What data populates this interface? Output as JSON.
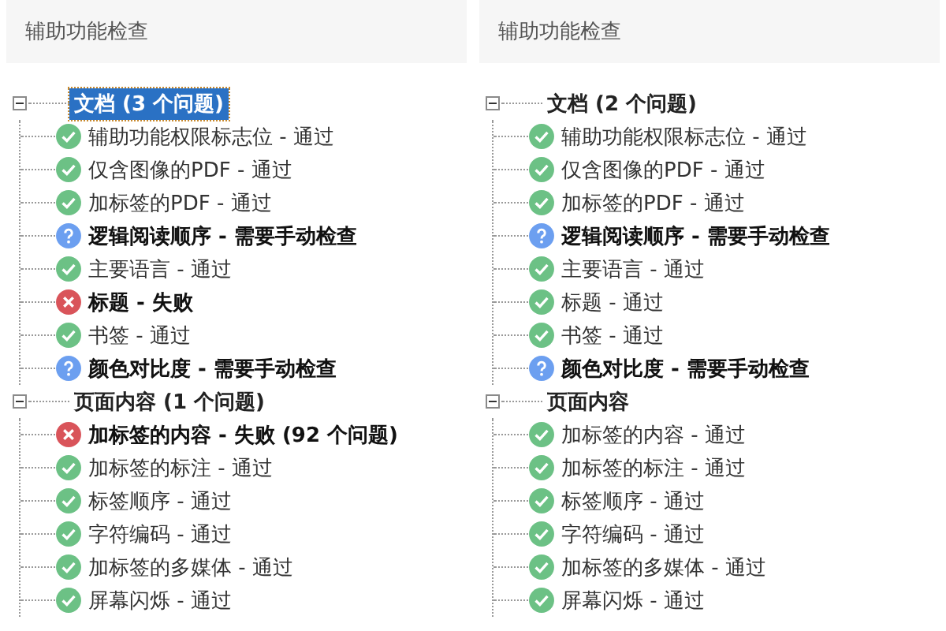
{
  "panels": [
    {
      "title": "辅助功能检查",
      "sections": [
        {
          "label": "文档 (3 个问题)",
          "selected": true,
          "expanded": true,
          "items": [
            {
              "label": "辅助功能权限标志位 - 通过",
              "kind": "pass"
            },
            {
              "label": "仅含图像的PDF - 通过",
              "kind": "pass"
            },
            {
              "label": "加标签的PDF - 通过",
              "kind": "pass"
            },
            {
              "label": "逻辑阅读顺序 - 需要手动检查",
              "kind": "manual"
            },
            {
              "label": "主要语言 - 通过",
              "kind": "pass"
            },
            {
              "label": "标题 - 失败",
              "kind": "fail"
            },
            {
              "label": "书签 - 通过",
              "kind": "pass"
            },
            {
              "label": "颜色对比度 - 需要手动检查",
              "kind": "manual"
            }
          ]
        },
        {
          "label": "页面内容 (1 个问题)",
          "selected": false,
          "expanded": true,
          "items": [
            {
              "label": "加标签的内容 - 失败 (92 个问题)",
              "kind": "fail"
            },
            {
              "label": "加标签的标注 - 通过",
              "kind": "pass"
            },
            {
              "label": "标签顺序 - 通过",
              "kind": "pass"
            },
            {
              "label": "字符编码 - 通过",
              "kind": "pass"
            },
            {
              "label": "加标签的多媒体 - 通过",
              "kind": "pass"
            },
            {
              "label": "屏幕闪烁 - 通过",
              "kind": "pass"
            }
          ]
        }
      ]
    },
    {
      "title": "辅助功能检查",
      "sections": [
        {
          "label": "文档 (2 个问题)",
          "selected": false,
          "expanded": true,
          "items": [
            {
              "label": "辅助功能权限标志位 - 通过",
              "kind": "pass"
            },
            {
              "label": "仅含图像的PDF - 通过",
              "kind": "pass"
            },
            {
              "label": "加标签的PDF - 通过",
              "kind": "pass"
            },
            {
              "label": "逻辑阅读顺序 - 需要手动检查",
              "kind": "manual"
            },
            {
              "label": "主要语言 - 通过",
              "kind": "pass"
            },
            {
              "label": "标题 - 通过",
              "kind": "pass"
            },
            {
              "label": "书签 - 通过",
              "kind": "pass"
            },
            {
              "label": "颜色对比度 - 需要手动检查",
              "kind": "manual"
            }
          ]
        },
        {
          "label": "页面内容",
          "selected": false,
          "expanded": true,
          "items": [
            {
              "label": "加标签的内容 - 通过",
              "kind": "pass"
            },
            {
              "label": "加标签的标注 - 通过",
              "kind": "pass"
            },
            {
              "label": "标签顺序 - 通过",
              "kind": "pass"
            },
            {
              "label": "字符编码 - 通过",
              "kind": "pass"
            },
            {
              "label": "加标签的多媒体 - 通过",
              "kind": "pass"
            },
            {
              "label": "屏幕闪烁 - 通过",
              "kind": "pass"
            }
          ]
        }
      ]
    }
  ]
}
